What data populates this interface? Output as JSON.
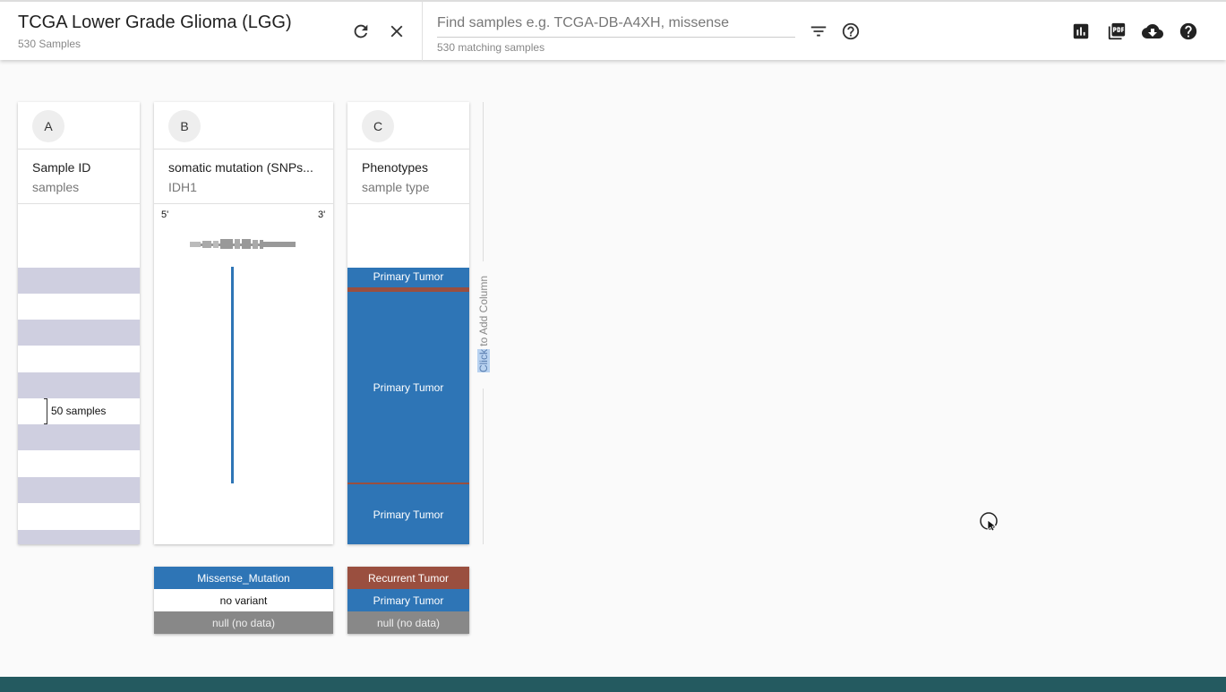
{
  "header": {
    "cohort_title": "TCGA Lower Grade Glioma (LGG)",
    "cohort_samples": "530 Samples",
    "search_placeholder": "Find samples e.g. TCGA-DB-A4XH, missense",
    "search_value": "",
    "matching": "530 matching samples"
  },
  "colors": {
    "primary_tumor": "#2e75b6",
    "recurrent_tumor": "#9a4f3f",
    "null": "#888888",
    "sample_band": "#cfcfe0",
    "footer": "#245a60"
  },
  "columns": [
    {
      "letter": "A",
      "field": "Sample ID",
      "subfield": "samples",
      "bracket_label": "50 samples"
    },
    {
      "letter": "B",
      "field": "somatic mutation (SNPs...",
      "subfield": "IDH1",
      "five_prime": "5'",
      "three_prime": "3'"
    },
    {
      "letter": "C",
      "field": "Phenotypes",
      "subfield": "sample type",
      "segments": [
        {
          "label": "Primary Tumor",
          "color": "primary"
        },
        {
          "label": "",
          "color": "recurrent"
        },
        {
          "label": "Primary Tumor",
          "color": "primary"
        },
        {
          "label": "",
          "color": "recurrent"
        },
        {
          "label": "Primary Tumor",
          "color": "primary"
        }
      ]
    }
  ],
  "add_column": {
    "click": "Click",
    "rest": " to Add Column"
  },
  "legend_b": [
    "Missense_Mutation",
    "no variant",
    "null (no data)"
  ],
  "legend_c": [
    "Recurrent Tumor",
    "Primary Tumor",
    "null (no data)"
  ],
  "icons": {
    "refresh": "refresh-icon",
    "close": "close-icon",
    "filter": "filter-icon",
    "help": "help-icon",
    "chart": "bar-chart-icon",
    "pdf": "pdf-icon",
    "download": "cloud-download-icon",
    "help2": "help-icon"
  }
}
